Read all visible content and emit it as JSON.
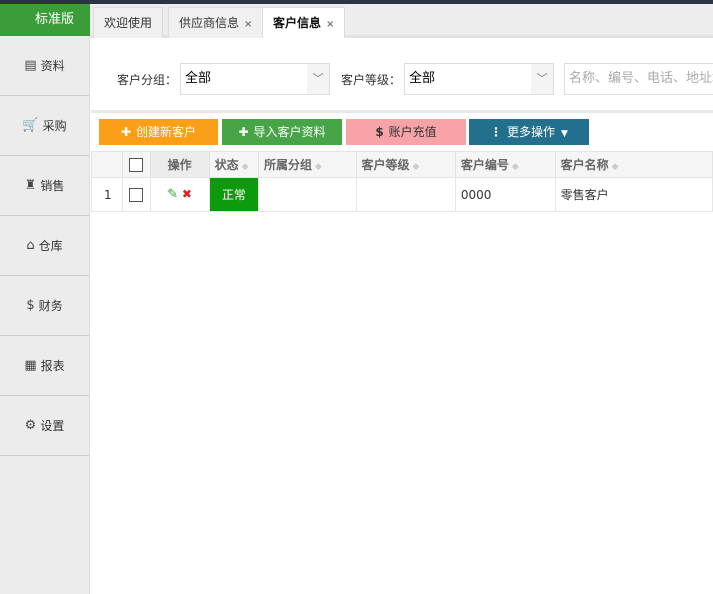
{
  "brand": "标准版",
  "sidebar": [
    {
      "label": "资料",
      "icon": "database-icon",
      "glyph": "▤"
    },
    {
      "label": "采购",
      "icon": "cart-icon",
      "glyph": "🛒"
    },
    {
      "label": "销售",
      "icon": "sales-icon",
      "glyph": "♜"
    },
    {
      "label": "仓库",
      "icon": "warehouse-icon",
      "glyph": "⌂"
    },
    {
      "label": "财务",
      "icon": "money-icon",
      "glyph": "$"
    },
    {
      "label": "报表",
      "icon": "report-icon",
      "glyph": "▦"
    },
    {
      "label": "设置",
      "icon": "gear-icon",
      "glyph": "⚙"
    }
  ],
  "tabs": [
    {
      "label": "欢迎使用"
    },
    {
      "label": "供应商信息",
      "close": "×"
    },
    {
      "label": "客户信息",
      "close": "×"
    }
  ],
  "filter": {
    "group_label": "客户分组：",
    "group_value": "全部",
    "level_label": "客户等级：",
    "level_value": "全部",
    "search_placeholder": "名称、编号、电话、地址均"
  },
  "buttons": {
    "create": "创建新客户",
    "import": "导入客户资料",
    "recharge": "账户充值",
    "more": "更多操作"
  },
  "colors": {
    "create": "#fb9e18",
    "import": "#47a447",
    "recharge": "#f8a3a7",
    "more": "#236f8e"
  },
  "table": {
    "headers": [
      "操作",
      "状态",
      "所属分组",
      "客户等级",
      "客户编号",
      "客户名称"
    ],
    "rows": [
      {
        "index": "1",
        "status": "正常",
        "group": "",
        "level": "",
        "code": "0000",
        "name": "零售客户"
      }
    ]
  }
}
